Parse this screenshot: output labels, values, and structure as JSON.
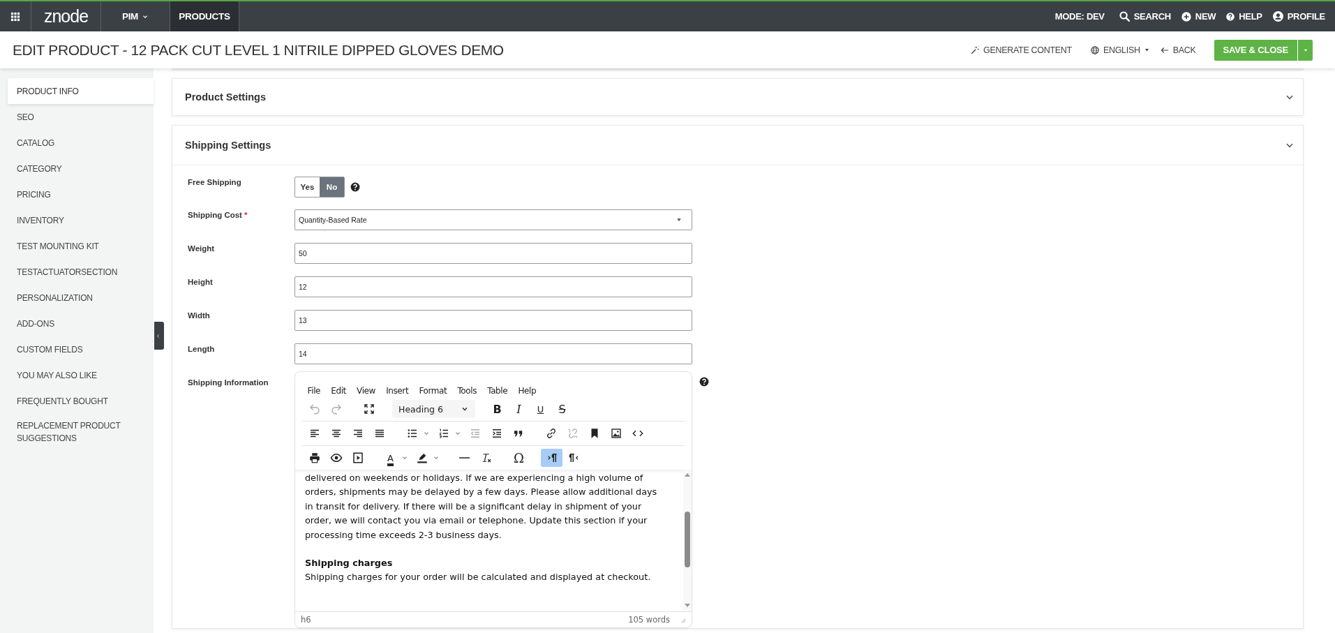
{
  "top_bar": {
    "logo": "znode",
    "menus": [
      {
        "label": "PIM",
        "selected": false,
        "dropdown": true
      },
      {
        "label": "PRODUCTS",
        "selected": true,
        "dropdown": false
      }
    ],
    "mode": "MODE: DEV",
    "actions": [
      {
        "label": "SEARCH",
        "kind": "search"
      },
      {
        "label": "NEW",
        "kind": "new"
      },
      {
        "label": "HELP",
        "kind": "help"
      },
      {
        "label": "PROFILE",
        "kind": "profile"
      }
    ]
  },
  "header": {
    "title": "EDIT PRODUCT - 12 PACK CUT LEVEL 1 NITRILE DIPPED GLOVES DEMO",
    "generate": "GENERATE CONTENT",
    "language": "ENGLISH",
    "back": "BACK",
    "save": "SAVE & CLOSE"
  },
  "sidebar": {
    "items": [
      {
        "label": "PRODUCT INFO",
        "selected": true
      },
      {
        "label": "SEO",
        "selected": false
      },
      {
        "label": "CATALOG",
        "selected": false
      },
      {
        "label": "CATEGORY",
        "selected": false
      },
      {
        "label": "PRICING",
        "selected": false
      },
      {
        "label": "INVENTORY",
        "selected": false
      },
      {
        "label": "TEST MOUNTING KIT",
        "selected": false
      },
      {
        "label": "TESTACTUATORSECTION",
        "selected": false
      },
      {
        "label": "PERSONALIZATION",
        "selected": false
      },
      {
        "label": "ADD-ONS",
        "selected": false
      },
      {
        "label": "CUSTOM FIELDS",
        "selected": false
      },
      {
        "label": "YOU MAY ALSO LIKE",
        "selected": false
      },
      {
        "label": "FREQUENTLY BOUGHT",
        "selected": false
      },
      {
        "label": "REPLACEMENT PRODUCT SUGGESTIONS",
        "selected": false
      }
    ]
  },
  "sections": [
    {
      "title": "Product Settings",
      "expanded": false
    },
    {
      "title": "Shipping Settings",
      "expanded": true
    }
  ],
  "shipping": {
    "fields": [
      {
        "label": "Free Shipping",
        "kind": "toggle",
        "help": true,
        "options": [
          {
            "label": "Yes",
            "selected": false
          },
          {
            "label": "No",
            "selected": true
          }
        ]
      },
      {
        "label": "Shipping Cost",
        "kind": "select",
        "required_mark": "*",
        "value": "Quantity-Based Rate"
      },
      {
        "label": "Weight",
        "kind": "text",
        "value": "50"
      },
      {
        "label": "Height",
        "kind": "text",
        "value": "12"
      },
      {
        "label": "Width",
        "kind": "text",
        "value": "13"
      },
      {
        "label": "Length",
        "kind": "text",
        "value": "14"
      },
      {
        "label": "Shipping Information",
        "kind": "editor",
        "help": true
      }
    ],
    "editor": {
      "menu": [
        "File",
        "Edit",
        "View",
        "Insert",
        "Format",
        "Tools",
        "Table",
        "Help"
      ],
      "block_format": "Heading 6",
      "format_chars": [
        "B",
        "I",
        "U",
        "S"
      ],
      "text_color_char": "A",
      "special_char": "Ω",
      "undo_disabled": true,
      "redo_disabled": true,
      "outdent_disabled": true,
      "unlink_disabled": true,
      "ltr_on": true,
      "rtl_on": false,
      "content": [
        {
          "kind": "paragraph",
          "text": "delivered on weekends or holidays. If we are experiencing a high volume of orders, shipments may be delayed by a few days. Please allow additional days in transit for delivery. If there will be a significant delay in shipment of your order, we will contact you via email or telephone. Update this section if your processing time exceeds 2-3 business days."
        },
        {
          "kind": "heading",
          "text": "Shipping charges"
        },
        {
          "kind": "paragraph",
          "text": "Shipping charges for your order will be calculated and displayed at checkout."
        }
      ],
      "path": "h6",
      "word_count": "105 words"
    }
  }
}
